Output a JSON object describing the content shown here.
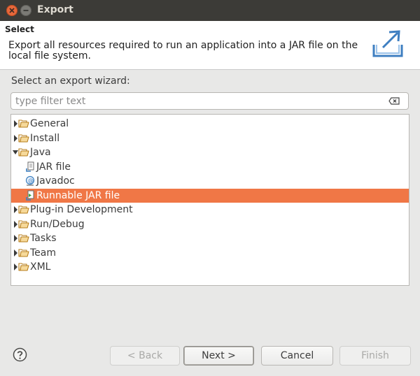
{
  "window": {
    "title": "Export"
  },
  "header": {
    "title": "Select",
    "description": "Export all resources required to run an application into a JAR file on the local file system.",
    "icon": "export-icon"
  },
  "wizard": {
    "label": "Select an export wizard:",
    "filter_placeholder": "type filter text",
    "filter_value": ""
  },
  "tree": {
    "items": [
      {
        "label": "General",
        "icon": "folder-icon",
        "expandable": true,
        "expanded": false,
        "level": 0
      },
      {
        "label": "Install",
        "icon": "folder-icon",
        "expandable": true,
        "expanded": false,
        "level": 0
      },
      {
        "label": "Java",
        "icon": "folder-icon",
        "expandable": true,
        "expanded": true,
        "level": 0
      },
      {
        "label": "JAR file",
        "icon": "jar-file-icon",
        "expandable": false,
        "level": 1
      },
      {
        "label": "Javadoc",
        "icon": "javadoc-icon",
        "expandable": false,
        "level": 1
      },
      {
        "label": "Runnable JAR file",
        "icon": "runnable-jar-icon",
        "expandable": false,
        "level": 1,
        "selected": true
      },
      {
        "label": "Plug-in Development",
        "icon": "folder-icon",
        "expandable": true,
        "expanded": false,
        "level": 0
      },
      {
        "label": "Run/Debug",
        "icon": "folder-icon",
        "expandable": true,
        "expanded": false,
        "level": 0
      },
      {
        "label": "Tasks",
        "icon": "folder-icon",
        "expandable": true,
        "expanded": false,
        "level": 0
      },
      {
        "label": "Team",
        "icon": "folder-icon",
        "expandable": true,
        "expanded": false,
        "level": 0
      },
      {
        "label": "XML",
        "icon": "folder-icon",
        "expandable": true,
        "expanded": false,
        "level": 0
      }
    ]
  },
  "buttons": {
    "back": "< Back",
    "next": "Next >",
    "cancel": "Cancel",
    "finish": "Finish"
  },
  "colors": {
    "selection": "#f07746",
    "titlebar": "#3c3b37",
    "close": "#e7683b"
  }
}
